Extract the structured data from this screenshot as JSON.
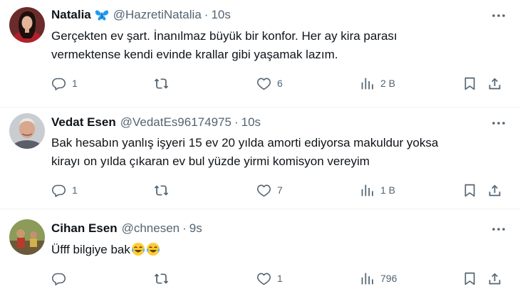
{
  "tweets": [
    {
      "name": "Natalia",
      "badge_icon": "butterfly-icon",
      "handle": "@HazretiNatalia",
      "time": "10s",
      "text_lines": [
        "Gerçekten ev şart. İnanılmaz büyük bir konfor. Her ay kira parası",
        "vermektense kendi evinde krallar gibi yaşamak lazım."
      ],
      "replies": "1",
      "retweets": "",
      "likes": "6",
      "views": "2 B"
    },
    {
      "name": "Vedat Esen",
      "handle": "@VedatEs96174975",
      "time": "10s",
      "text_lines": [
        "Bak hesabın yanlış işyeri 15 ev 20 yılda amorti ediyorsa makuldur yoksa",
        "kirayı on yılda çıkaran ev bul yüzde yirmi komisyon vereyim"
      ],
      "replies": "1",
      "retweets": "",
      "likes": "7",
      "views": "1 B"
    },
    {
      "name": "Cihan Esen",
      "handle": "@chnesen",
      "time": "9s",
      "text": "Üfff bilgiye bak",
      "emoji": [
        "face-with-tears-of-joy",
        "face-with-tears-of-joy"
      ],
      "replies": "",
      "retweets": "",
      "likes": "1",
      "views": "796"
    }
  ],
  "dot": "·",
  "colors": {
    "text": "#0f1419",
    "secondary": "#536471",
    "divider": "#eff3f4",
    "badge": "#1d9bf0"
  }
}
